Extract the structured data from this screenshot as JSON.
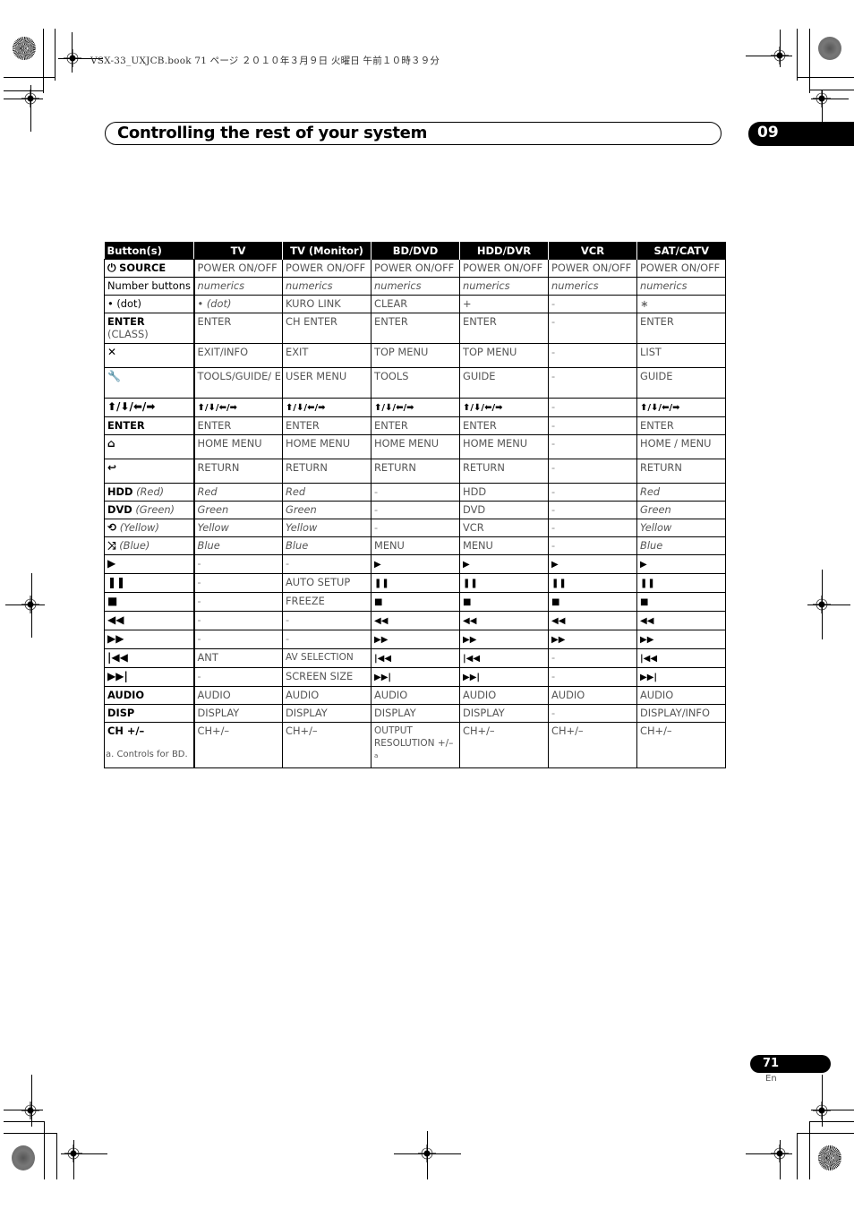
{
  "header_meta": "VSX-33_UXJCB.book  71 ページ  ２０１０年３月９日  火曜日  午前１０時３９分",
  "section_title": "Controlling the rest of your system",
  "chapter_number": "09",
  "table": {
    "columns": [
      "Button(s)",
      "TV",
      "TV (Monitor)",
      "BD/DVD",
      "HDD/DVR",
      "VCR",
      "SAT/CATV"
    ],
    "rows": [
      {
        "button_icon": "power-icon",
        "button_glyph": "⏻",
        "button_bold": "SOURCE",
        "button_text": "",
        "cells": [
          "POWER ON/OFF",
          "POWER ON/OFF",
          "POWER ON/OFF",
          "POWER ON/OFF",
          "POWER ON/OFF",
          "POWER ON/OFF"
        ]
      },
      {
        "button_text": "Number buttons",
        "cells": [
          "numerics",
          "numerics",
          "numerics",
          "numerics",
          "numerics",
          "numerics"
        ]
      },
      {
        "button_text": "• (dot)",
        "cells": [
          "• (dot)",
          "KURO LINK",
          "CLEAR",
          "+",
          "-",
          "∗"
        ]
      },
      {
        "button_bold": "ENTER",
        "button_text": "(CLASS)",
        "cells": [
          "ENTER",
          "CH ENTER",
          "ENTER",
          "ENTER",
          "-",
          "ENTER"
        ]
      },
      {
        "button_icon": "close-x-icon",
        "button_glyph": "✕",
        "cells": [
          "EXIT/INFO",
          "EXIT",
          "TOP MENU",
          "TOP MENU",
          "-",
          "LIST"
        ]
      },
      {
        "button_icon": "wrench-tools-icon",
        "button_glyph": "🔧",
        "cells": [
          "TOOLS/GUIDE/ EPG",
          "USER MENU",
          "TOOLS",
          "GUIDE",
          "-",
          "GUIDE"
        ]
      },
      {
        "button_glyph": "⬆/⬇/⬅/➡",
        "button_icon": "arrow-keys-icon",
        "cells": [
          "⬆/⬇/⬅/➡",
          "⬆/⬇/⬅/➡",
          "⬆/⬇/⬅/➡",
          "⬆/⬇/⬅/➡",
          "-",
          "⬆/⬇/⬅/➡"
        ]
      },
      {
        "button_bold": "ENTER",
        "cells": [
          "ENTER",
          "ENTER",
          "ENTER",
          "ENTER",
          "-",
          "ENTER"
        ]
      },
      {
        "button_icon": "home-icon",
        "button_glyph": "⌂",
        "cells": [
          "HOME MENU",
          "HOME MENU",
          "HOME MENU",
          "HOME MENU",
          "-",
          "HOME / MENU"
        ]
      },
      {
        "button_icon": "return-icon",
        "button_glyph": "↩",
        "cells": [
          "RETURN",
          "RETURN",
          "RETURN",
          "RETURN",
          "-",
          "RETURN"
        ]
      },
      {
        "button_bold": "HDD",
        "button_italic": "(Red)",
        "cells": [
          "Red",
          "Red",
          "-",
          "HDD",
          "-",
          "Red"
        ]
      },
      {
        "button_bold": "DVD",
        "button_italic": "(Green)",
        "cells": [
          "Green",
          "Green",
          "-",
          "DVD",
          "-",
          "Green"
        ]
      },
      {
        "button_icon": "repeat-icon",
        "button_glyph": "⟲",
        "button_italic": "(Yellow)",
        "cells": [
          "Yellow",
          "Yellow",
          "-",
          "VCR",
          "-",
          "Yellow"
        ]
      },
      {
        "button_icon": "shuffle-icon",
        "button_glyph": "⤨",
        "button_italic": "(Blue)",
        "cells": [
          "Blue",
          "Blue",
          "MENU",
          "MENU",
          "-",
          "Blue"
        ]
      },
      {
        "button_icon": "play-icon",
        "button_glyph": "▶",
        "cells": [
          "-",
          "-",
          "▶",
          "▶",
          "▶",
          "▶"
        ]
      },
      {
        "button_icon": "pause-icon",
        "button_glyph": "❚❚",
        "cells": [
          "-",
          "AUTO SETUP",
          "❚❚",
          "❚❚",
          "❚❚",
          "❚❚"
        ]
      },
      {
        "button_icon": "stop-icon",
        "button_glyph": "■",
        "cells": [
          "-",
          "FREEZE",
          "■",
          "■",
          "■",
          "■"
        ]
      },
      {
        "button_icon": "rewind-icon",
        "button_glyph": "◀◀",
        "cells": [
          "-",
          "-",
          "◀◀",
          "◀◀",
          "◀◀",
          "◀◀"
        ]
      },
      {
        "button_icon": "fast-forward-icon",
        "button_glyph": "▶▶",
        "cells": [
          "-",
          "-",
          "▶▶",
          "▶▶",
          "▶▶",
          "▶▶"
        ]
      },
      {
        "button_icon": "skip-previous-icon",
        "button_glyph": "|◀◀",
        "cells": [
          "ANT",
          "AV SELECTION",
          "|◀◀",
          "|◀◀",
          "-",
          "|◀◀"
        ]
      },
      {
        "button_icon": "skip-next-icon",
        "button_glyph": "▶▶|",
        "cells": [
          "-",
          "SCREEN SIZE",
          "▶▶|",
          "▶▶|",
          "-",
          "▶▶|"
        ]
      },
      {
        "button_bold": "AUDIO",
        "cells": [
          "AUDIO",
          "AUDIO",
          "AUDIO",
          "AUDIO",
          "AUDIO",
          "AUDIO"
        ]
      },
      {
        "button_bold": "DISP",
        "cells": [
          "DISPLAY",
          "DISPLAY",
          "DISPLAY",
          "DISPLAY",
          "-",
          "DISPLAY/INFO"
        ]
      },
      {
        "button_bold": "CH +/–",
        "cells": [
          "CH+/–",
          "CH+/–",
          "OUTPUT RESOLUTION +/–",
          "CH+/–",
          "CH+/–",
          "CH+/–"
        ],
        "footnote_marker": "a"
      }
    ]
  },
  "footnote": "a. Controls for BD.",
  "page_number": "71",
  "page_lang": "En"
}
